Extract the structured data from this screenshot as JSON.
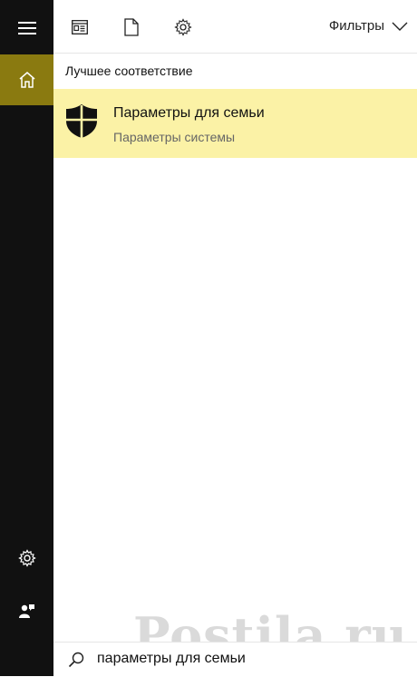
{
  "sidebar": {
    "items": [
      {
        "icon": "hamburger-menu-icon"
      },
      {
        "icon": "home-icon",
        "active": true
      },
      {
        "icon": "gear-icon"
      },
      {
        "icon": "feedback-icon"
      }
    ],
    "accent_color": "#8a7a10"
  },
  "toolbar": {
    "icons": [
      "apps-icon",
      "document-icon",
      "settings-gear-icon"
    ],
    "filters_label": "Фильтры"
  },
  "results": {
    "section_title": "Лучшее соответствие",
    "best_match": {
      "title": "Параметры для семьи",
      "subtitle": "Параметры системы",
      "icon": "family-shield-icon",
      "highlight_color": "#fbf2a6"
    }
  },
  "search": {
    "value": "параметры для семьи",
    "icon": "search-icon"
  },
  "watermark": "Postila.ru"
}
